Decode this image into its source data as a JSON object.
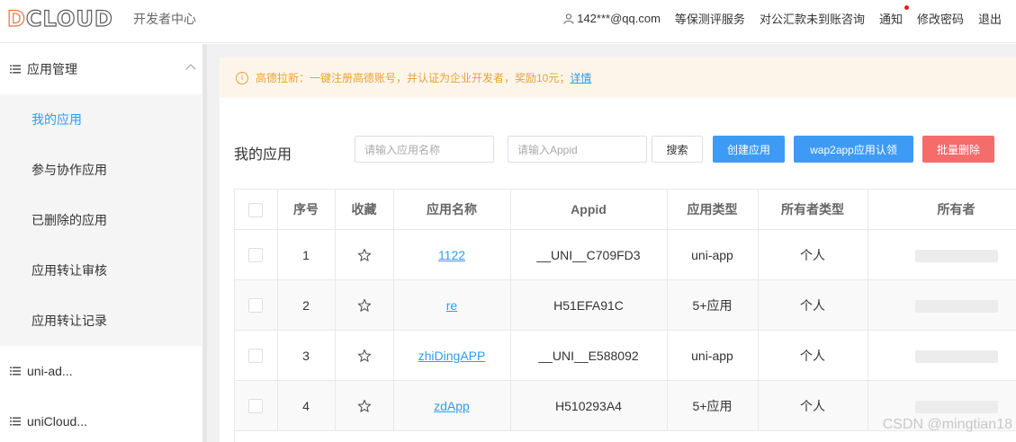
{
  "brand": {
    "logo_text": "DCLOUD",
    "logo_first": "D",
    "logo_rest": "CLOUD",
    "subtitle": "开发者中心",
    "accent_color": "#f36e3e"
  },
  "topnav": {
    "user": "142***@qq.com",
    "items": [
      "等保测评服务",
      "对公汇款未到账咨询",
      "通知",
      "修改密码",
      "退出"
    ]
  },
  "sidebar": {
    "groups": [
      {
        "label": "应用管理",
        "expanded": true,
        "icon": "list-icon",
        "items": [
          "我的应用",
          "参与协作应用",
          "已删除的应用",
          "应用转让审核",
          "应用转让记录"
        ],
        "active_item": "我的应用"
      },
      {
        "label": "uni-ad...",
        "icon": "list-icon"
      },
      {
        "label": "uniCloud...",
        "icon": "list-icon"
      }
    ]
  },
  "alert": {
    "icon": "info-icon",
    "text": "高德拉新：一键注册高德账号，并认证为企业开发者，奖励10元；",
    "link": "详情",
    "color": "#e6a23c"
  },
  "toolbar": {
    "title": "我的应用",
    "name_placeholder": "请输入应用名称",
    "appid_placeholder": "请输入Appid",
    "search_label": "搜索",
    "create_label": "创建应用",
    "claim_label": "wap2app应用认领",
    "batch_delete_label": "批量删除"
  },
  "table": {
    "headers": [
      "",
      "序号",
      "收藏",
      "应用名称",
      "Appid",
      "应用类型",
      "所有者类型",
      "所有者"
    ],
    "rows": [
      {
        "index": "1",
        "name": "1122",
        "appid": "__UNI__C709FD3",
        "type": "uni-app",
        "owner_type": "个人"
      },
      {
        "index": "2",
        "name": "re",
        "appid": "H51EFA91C",
        "type": "5+应用",
        "owner_type": "个人"
      },
      {
        "index": "3",
        "name": "zhiDingAPP",
        "appid": "__UNI__E588092",
        "type": "uni-app",
        "owner_type": "个人"
      },
      {
        "index": "4",
        "name": "zdApp",
        "appid": "H510293A4",
        "type": "5+应用",
        "owner_type": "个人"
      }
    ]
  },
  "watermark": "CSDN @mingtian18"
}
